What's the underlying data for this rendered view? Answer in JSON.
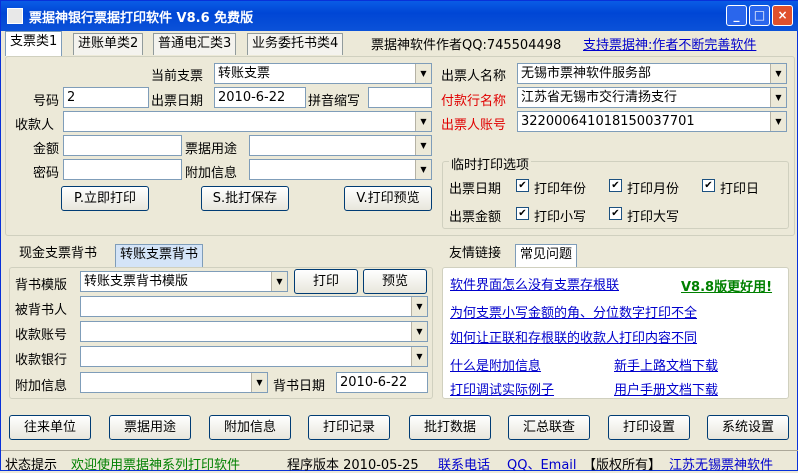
{
  "window": {
    "title": "票据神银行票据打印软件 V8.6 免费版"
  },
  "tabs": [
    "支票类1",
    "进账单类2",
    "普通电汇类3",
    "业务委托书类4"
  ],
  "header": {
    "author": "票据神软件作者QQ:745504498",
    "support": "支持票据神:作者不断完善软件"
  },
  "form": {
    "current_check_label": "当前支票",
    "current_check": "转账支票",
    "number_label": "号码",
    "number": "2",
    "date_label": "出票日期",
    "date": "2010-6-22",
    "pinyin_label": "拼音缩写",
    "pinyin": "",
    "payee_label": "收款人",
    "payee": "",
    "amount_label": "金额",
    "amount": "",
    "usage_label": "票据用途",
    "usage": "",
    "password_label": "密码",
    "password": "",
    "extra_label": "附加信息",
    "extra": ""
  },
  "drawer": {
    "name_label": "出票人名称",
    "name": "无锡市票神软件服务部",
    "bank_label": "付款行名称",
    "bank": "江苏省无锡市交行清扬支行",
    "account_label": "出票人账号",
    "account": "322000641018150037701"
  },
  "actions": {
    "print": "P.立即打印",
    "batch_save": "S.批打保存",
    "preview": "V.打印预览"
  },
  "temp_print": {
    "title": "临时打印选项",
    "date_label": "出票日期",
    "amount_label": "出票金额",
    "print_year": "打印年份",
    "print_month": "打印月份",
    "print_day": "打印日",
    "print_small": "打印小写",
    "print_big": "打印大写"
  },
  "endorse": {
    "tabs": [
      "现金支票背书",
      "转账支票背书"
    ],
    "template_label": "背书模版",
    "template": "转账支票背书模版",
    "print_btn": "打印",
    "preview_btn": "预览",
    "endorsee_label": "被背书人",
    "account_label": "收款账号",
    "bank_label": "收款银行",
    "extra_label": "附加信息",
    "date_label": "背书日期",
    "date": "2010-6-22"
  },
  "help": {
    "tabs": [
      "友情链接",
      "常见问题"
    ],
    "links": [
      "软件界面怎么没有支票存根联",
      "为何支票小写金额的角、分位数字打印不全",
      "如何让正联和存根联的收款人打印内容不同",
      "什么是附加信息",
      "打印调试实际例子"
    ],
    "version_link": "V8.8版更好用!",
    "downloads": [
      "新手上路文档下载",
      "用户手册文档下载"
    ]
  },
  "bottom_buttons": [
    "往来单位",
    "票据用途",
    "附加信息",
    "打印记录",
    "批打数据",
    "汇总联查",
    "打印设置",
    "系统设置"
  ],
  "status": {
    "label": "状态提示",
    "message": "欢迎使用票据神系列打印软件",
    "version": "程序版本 2010-05-25",
    "contact": "联系电话",
    "qq": "QQ、Email",
    "copyright": "【版权所有】",
    "company": "江苏无锡票神软件"
  },
  "colors": {
    "titlebar": "#0a5ce6",
    "required_label": "#e00000",
    "link": "#0000cc",
    "status_message": "#008000"
  }
}
